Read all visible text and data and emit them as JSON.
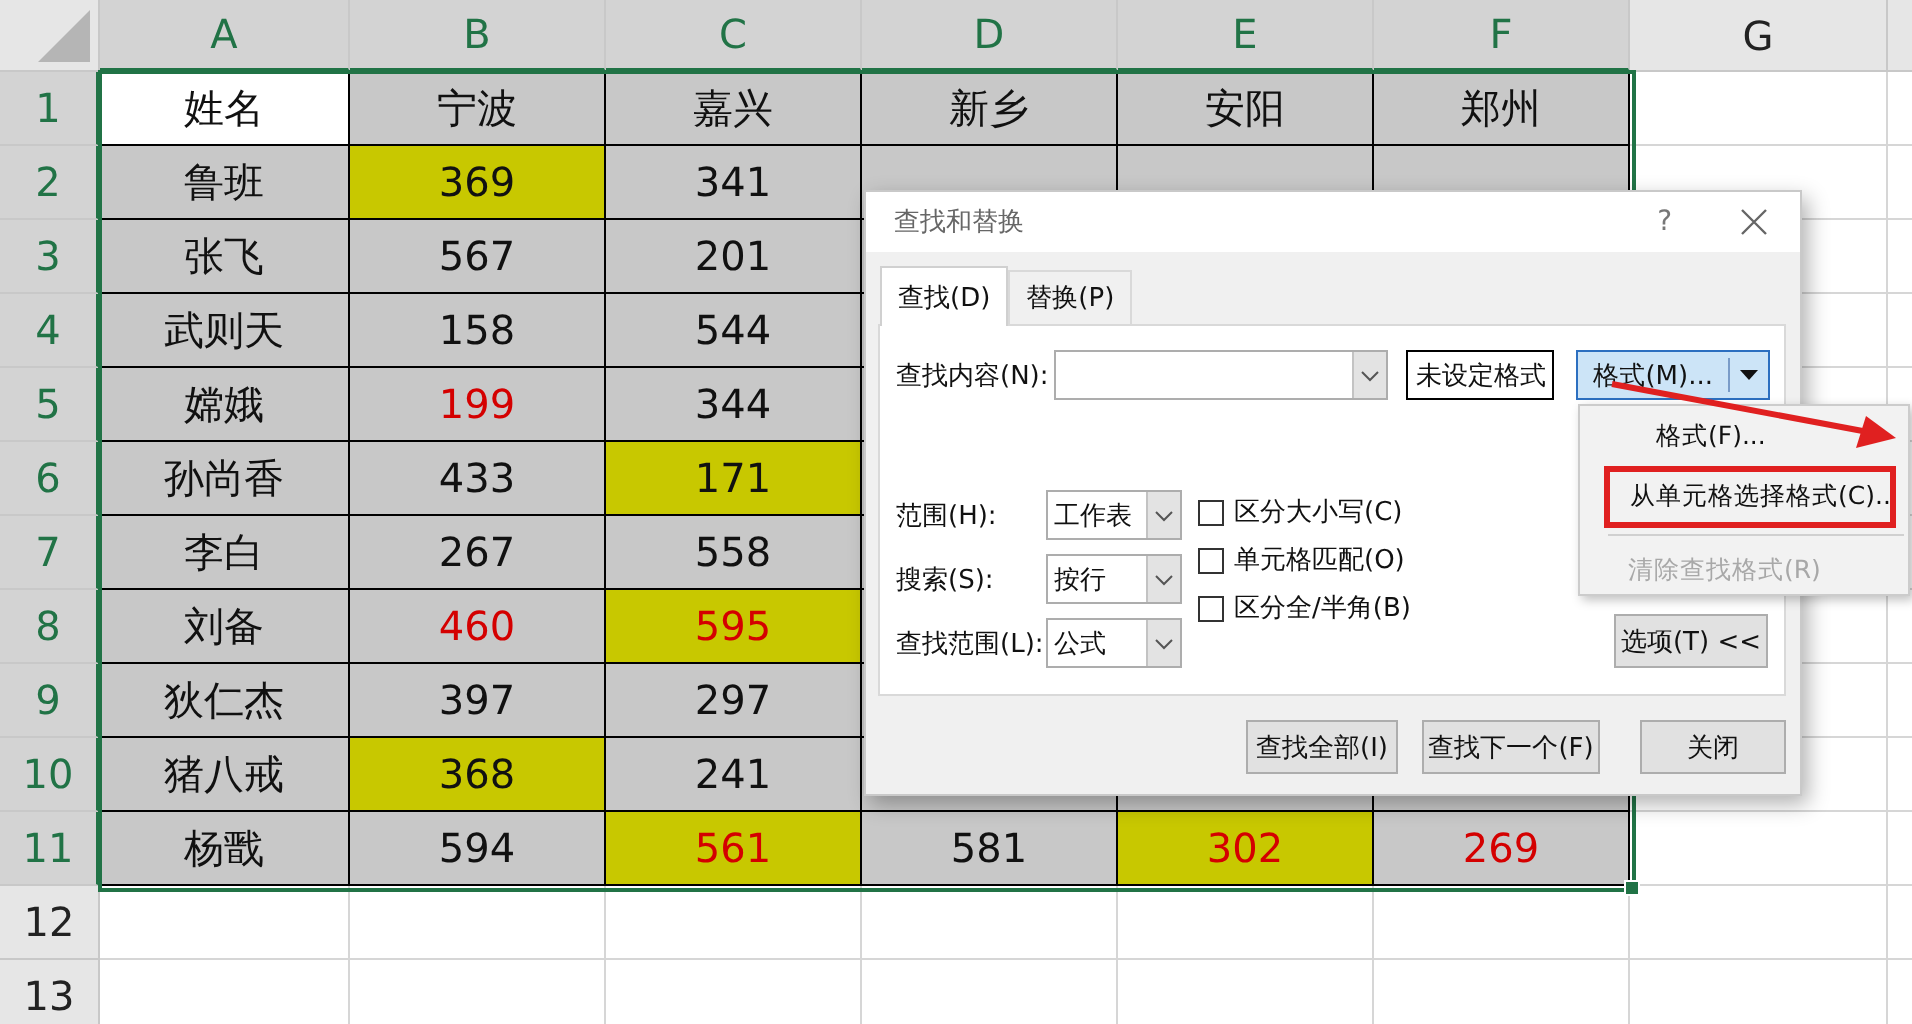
{
  "sheet": {
    "columns": [
      {
        "label": "A",
        "selected": true
      },
      {
        "label": "B",
        "selected": true
      },
      {
        "label": "C",
        "selected": true
      },
      {
        "label": "D",
        "selected": true
      },
      {
        "label": "E",
        "selected": true
      },
      {
        "label": "F",
        "selected": true
      },
      {
        "label": "G",
        "selected": false
      }
    ],
    "rows": [
      {
        "label": "1",
        "selected": true,
        "cells": [
          {
            "text": "姓名",
            "kind": "plain"
          },
          {
            "text": "宁波"
          },
          {
            "text": "嘉兴"
          },
          {
            "text": "新乡"
          },
          {
            "text": "安阳"
          },
          {
            "text": "郑州"
          }
        ]
      },
      {
        "label": "2",
        "selected": true,
        "cells": [
          {
            "text": "鲁班"
          },
          {
            "text": "369",
            "highlighted": true
          },
          {
            "text": "341"
          }
        ]
      },
      {
        "label": "3",
        "selected": true,
        "cells": [
          {
            "text": "张飞"
          },
          {
            "text": "567"
          },
          {
            "text": "201"
          }
        ]
      },
      {
        "label": "4",
        "selected": true,
        "cells": [
          {
            "text": "武则天"
          },
          {
            "text": "158"
          },
          {
            "text": "544"
          }
        ]
      },
      {
        "label": "5",
        "selected": true,
        "cells": [
          {
            "text": "嫦娥"
          },
          {
            "text": "199",
            "flagged": true
          },
          {
            "text": "344"
          }
        ]
      },
      {
        "label": "6",
        "selected": true,
        "cells": [
          {
            "text": "孙尚香"
          },
          {
            "text": "433"
          },
          {
            "text": "171",
            "highlighted": true
          }
        ]
      },
      {
        "label": "7",
        "selected": true,
        "cells": [
          {
            "text": "李白"
          },
          {
            "text": "267"
          },
          {
            "text": "558"
          }
        ]
      },
      {
        "label": "8",
        "selected": true,
        "cells": [
          {
            "text": "刘备"
          },
          {
            "text": "460",
            "flagged": true
          },
          {
            "text": "595",
            "highlighted": true,
            "flagged": true
          }
        ]
      },
      {
        "label": "9",
        "selected": true,
        "cells": [
          {
            "text": "狄仁杰"
          },
          {
            "text": "397"
          },
          {
            "text": "297"
          }
        ]
      },
      {
        "label": "10",
        "selected": true,
        "cells": [
          {
            "text": "猪八戒"
          },
          {
            "text": "368",
            "highlighted": true
          },
          {
            "text": "241"
          }
        ]
      },
      {
        "label": "11",
        "selected": true,
        "cells": [
          {
            "text": "杨戬"
          },
          {
            "text": "594"
          },
          {
            "text": "561",
            "highlighted": true,
            "flagged": true
          },
          {
            "text": "581"
          },
          {
            "text": "302",
            "highlighted": true,
            "flagged": true
          },
          {
            "text": "269",
            "flagged": true
          }
        ]
      },
      {
        "label": "12",
        "selected": false
      },
      {
        "label": "13",
        "selected": false
      }
    ]
  },
  "dialog": {
    "title": "查找和替换",
    "help": "?",
    "tabs": [
      {
        "label": "查找(D)",
        "selected": true
      },
      {
        "label": "替换(P)",
        "selected": false
      }
    ],
    "find_label": "查找内容(N):",
    "format_status": "未设定格式",
    "format_button": "格式(M)...",
    "format_menu": [
      {
        "kind": "item",
        "label": "格式(F)...",
        "disabled": false,
        "marked": false
      },
      {
        "kind": "item",
        "label": "从单元格选择格式(C)..",
        "disabled": false,
        "marked": true
      },
      {
        "kind": "separator"
      },
      {
        "kind": "item",
        "label": "清除查找格式(R)",
        "disabled": true,
        "marked": false
      }
    ],
    "selects": [
      {
        "label": "范围(H):",
        "value": "工作表"
      },
      {
        "label": "搜索(S):",
        "value": "按行"
      },
      {
        "label": "查找范围(L):",
        "value": "公式"
      }
    ],
    "checkboxes": [
      {
        "label": "区分大小写(C)",
        "checked": false
      },
      {
        "label": "单元格匹配(O)",
        "checked": false
      },
      {
        "label": "区分全/半角(B)",
        "checked": false
      }
    ],
    "options_button": "选项(T) <<",
    "buttons": [
      "查找全部(I)",
      "查找下一个(F)",
      "关闭"
    ]
  }
}
